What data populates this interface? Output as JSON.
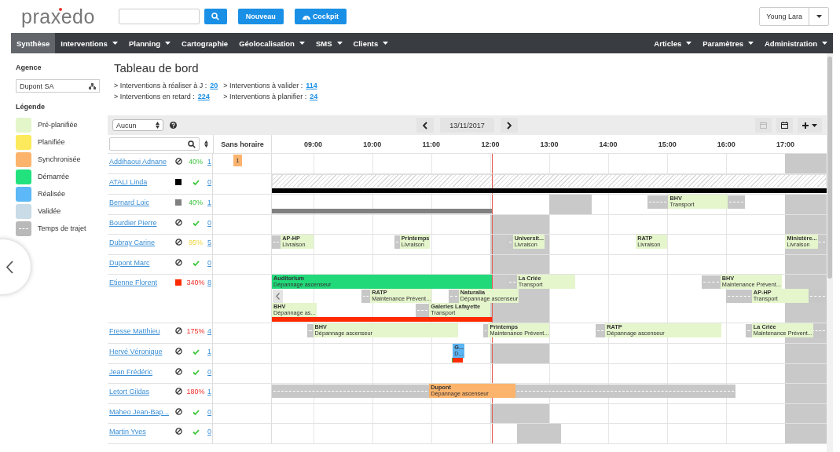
{
  "header": {
    "logo": "praxedo",
    "buttons": [
      {
        "label": "Nouveau",
        "kind": "text"
      },
      {
        "label": "Cockpit",
        "kind": "gauge"
      }
    ],
    "user": "Young Lara"
  },
  "nav": {
    "left": [
      {
        "label": "Synthèse",
        "selected": true,
        "dropdown": false
      },
      {
        "label": "Interventions",
        "selected": false,
        "dropdown": true
      },
      {
        "label": "Planning",
        "selected": false,
        "dropdown": true
      },
      {
        "label": "Cartographie",
        "selected": false,
        "dropdown": false
      },
      {
        "label": "Géolocalisation",
        "selected": false,
        "dropdown": true
      },
      {
        "label": "SMS",
        "selected": false,
        "dropdown": true
      },
      {
        "label": "Clients",
        "selected": false,
        "dropdown": true
      }
    ],
    "right": [
      {
        "label": "Articles",
        "selected": false,
        "dropdown": true
      },
      {
        "label": "Paramètres",
        "selected": false,
        "dropdown": true
      },
      {
        "label": "Administration",
        "selected": false,
        "dropdown": true
      }
    ]
  },
  "sidebar": {
    "agency_label": "Agence",
    "agency": "Dupont SA",
    "legend_title": "Légende",
    "legend": [
      {
        "label": "Pré-planifiée",
        "color": "#e3f6ca",
        "kind": "swatch"
      },
      {
        "label": "Planifiée",
        "color": "#fde95c",
        "kind": "swatch"
      },
      {
        "label": "Synchronisée",
        "color": "#fcb46c",
        "kind": "swatch"
      },
      {
        "label": "Démarrée",
        "color": "#22e27e",
        "kind": "swatch"
      },
      {
        "label": "Réalisée",
        "color": "#5cb8f6",
        "kind": "swatch"
      },
      {
        "label": "Validée",
        "color": "#c8dbe6",
        "kind": "swatch"
      },
      {
        "label": "Temps de trajet",
        "color": "#b9b9b9",
        "kind": "travel"
      }
    ]
  },
  "dashboard": {
    "title": "Tableau de bord",
    "stats": [
      {
        "label": "> Interventions à réaliser à J :",
        "value": "20"
      },
      {
        "label": "> Interventions à valider :",
        "value": "114"
      },
      {
        "label": "> Interventions en retard :",
        "value": "224"
      },
      {
        "label": "> Interventions à planifier :",
        "value": "24"
      }
    ]
  },
  "planning": {
    "filter": "Aucun",
    "date": "13/11/2017",
    "unassigned_header": "Sans horaire",
    "hours": [
      "09:00",
      "10:00",
      "11:00",
      "12:00",
      "13:00",
      "14:00",
      "15:00",
      "16:00",
      "17:00"
    ],
    "technicians": [
      {
        "name": "Addihaoui Adnane",
        "status": {
          "kind": "none"
        },
        "load": {
          "kind": "percent",
          "text": "40%",
          "warning": false,
          "overloaded": false
        },
        "count": "1",
        "unassigned": "1",
        "items": [
          {
            "kind": "off"
          }
        ]
      },
      {
        "name": "ATALI Linda",
        "status": {
          "kind": "square",
          "color": "#000000"
        },
        "load": {
          "kind": "check"
        },
        "count": "0",
        "items": [
          {
            "kind": "hatch"
          },
          {
            "kind": "bar",
            "color": "#000000"
          }
        ]
      },
      {
        "name": "Bernard Loic",
        "status": {
          "kind": "square",
          "color": "#808080"
        },
        "load": {
          "kind": "percent",
          "text": "40%",
          "warning": false,
          "overloaded": false
        },
        "count": "1",
        "items": [
          {
            "kind": "off"
          },
          {
            "kind": "off"
          },
          {
            "kind": "travel"
          },
          {
            "kind": "job",
            "color": "#e5f5cc",
            "title": "BHV",
            "subtitle": "Transport"
          },
          {
            "kind": "travel"
          },
          {
            "kind": "bar",
            "color": "#808080"
          }
        ]
      },
      {
        "name": "Bourdier Pierre",
        "status": {
          "kind": "none"
        },
        "load": {
          "kind": "check"
        },
        "count": "0",
        "items": [
          {
            "kind": "off"
          },
          {
            "kind": "off"
          }
        ]
      },
      {
        "name": "Dubray Carine",
        "status": {
          "kind": "none"
        },
        "load": {
          "kind": "percent",
          "text": "95%",
          "warning": true,
          "overloaded": false
        },
        "count": "5",
        "items": [
          {
            "kind": "off"
          },
          {
            "kind": "off"
          },
          {
            "kind": "travel"
          },
          {
            "kind": "job",
            "color": "#e5f5cc",
            "title": "AP-HP",
            "subtitle": "Livraison"
          },
          {
            "kind": "travel"
          },
          {
            "kind": "job",
            "color": "#e5f5cc",
            "title": "Printemps",
            "subtitle": "Livraison"
          },
          {
            "kind": "travel"
          },
          {
            "kind": "job",
            "color": "#e5f5cc",
            "title": "Universit...",
            "subtitle": "Livraison"
          },
          {
            "kind": "job",
            "color": "#e5f5cc",
            "title": "RATP",
            "subtitle": "Livraison"
          },
          {
            "kind": "job",
            "color": "#e5f5cc",
            "title": "Ministère...",
            "subtitle": "Livraison"
          },
          {
            "kind": "travel"
          }
        ]
      },
      {
        "name": "Dupont Marc",
        "status": {
          "kind": "none"
        },
        "load": {
          "kind": "check"
        },
        "count": "0",
        "items": [
          {
            "kind": "off"
          },
          {
            "kind": "off"
          }
        ]
      },
      {
        "name": "Etienne Florent",
        "status": {
          "kind": "square",
          "color": "#ff2a00"
        },
        "load": {
          "kind": "percent",
          "text": "340%",
          "warning": false,
          "overloaded": true
        },
        "count": "8",
        "items": [
          {
            "kind": "off"
          },
          {
            "kind": "off"
          },
          {
            "kind": "job",
            "color": "#22d97a",
            "title": "Auditorium",
            "subtitle": "Dépannage ascenseur"
          },
          {
            "kind": "travel"
          },
          {
            "kind": "job",
            "color": "#e5f5cc",
            "title": "La Criée",
            "subtitle": "Transport"
          },
          {
            "kind": "travel"
          },
          {
            "kind": "job",
            "color": "#e5f5cc",
            "title": "BHV",
            "subtitle": "Maintenance Prévent..."
          },
          {
            "kind": "scroll"
          },
          {
            "kind": "travel"
          },
          {
            "kind": "job",
            "color": "#e5f5cc",
            "title": "RATP",
            "subtitle": "Maintenance Prévent..."
          },
          {
            "kind": "travel"
          },
          {
            "kind": "job",
            "color": "#e5f5cc",
            "title": "Naturalia",
            "subtitle": "Dépannage ascenseur"
          },
          {
            "kind": "travel"
          },
          {
            "kind": "job",
            "color": "#e5f5cc",
            "title": "AP-HP",
            "subtitle": "Transport"
          },
          {
            "kind": "travel"
          },
          {
            "kind": "job",
            "color": "#e5f5cc",
            "title": "BHV",
            "subtitle": "Dépannage as..."
          },
          {
            "kind": "travel"
          },
          {
            "kind": "job",
            "color": "#e5f5cc",
            "title": "Galeries Lafayette",
            "subtitle": "Transport"
          },
          {
            "kind": "bar",
            "color": "#ff2a00"
          }
        ]
      },
      {
        "name": "Fresse Matthieu",
        "status": {
          "kind": "none"
        },
        "load": {
          "kind": "percent",
          "text": "175%",
          "warning": false,
          "overloaded": true
        },
        "count": "4",
        "items": [
          {
            "kind": "off"
          },
          {
            "kind": "travel"
          },
          {
            "kind": "job",
            "color": "#e5f5cc",
            "title": "BHV",
            "subtitle": "Dépannage ascenseur"
          },
          {
            "kind": "travel"
          },
          {
            "kind": "job",
            "color": "#e5f5cc",
            "title": "Printemps",
            "subtitle": "Maintenance Prévent..."
          },
          {
            "kind": "travel"
          },
          {
            "kind": "job",
            "color": "#e5f5cc",
            "title": "RATP",
            "subtitle": "Dépannage ascenseur"
          },
          {
            "kind": "travel"
          },
          {
            "kind": "job",
            "color": "#e5f5cc",
            "title": "La Criée",
            "subtitle": "Maintenance Prévent..."
          },
          {
            "kind": "travel"
          }
        ]
      },
      {
        "name": "Hervé Véronique",
        "status": {
          "kind": "none"
        },
        "load": {
          "kind": "check"
        },
        "count": "1",
        "items": [
          {
            "kind": "off"
          },
          {
            "kind": "off"
          },
          {
            "kind": "job",
            "color": "#5cb4f2",
            "title": "G...",
            "subtitle": "D..."
          },
          {
            "kind": "bar",
            "color": "#3cc63c"
          },
          {
            "kind": "bar",
            "color": "#ff2a00"
          }
        ]
      },
      {
        "name": "Jean Frédéric",
        "status": {
          "kind": "none"
        },
        "load": {
          "kind": "check"
        },
        "count": "0",
        "items": [
          {
            "kind": "off"
          }
        ]
      },
      {
        "name": "Letort Gildas",
        "status": {
          "kind": "none"
        },
        "load": {
          "kind": "percent",
          "text": "180%",
          "warning": false,
          "overloaded": true
        },
        "count": "1",
        "items": [
          {
            "kind": "off"
          },
          {
            "kind": "travel"
          },
          {
            "kind": "job",
            "color": "#fcb46c",
            "title": "Dupont",
            "subtitle": "Dépannage ascenseur"
          },
          {
            "kind": "travel"
          }
        ]
      },
      {
        "name": "Maheo Jean-Bap...",
        "status": {
          "kind": "none"
        },
        "load": {
          "kind": "check"
        },
        "count": "0",
        "items": [
          {
            "kind": "off"
          },
          {
            "kind": "off"
          }
        ]
      },
      {
        "name": "Martin Yves",
        "status": {
          "kind": "none"
        },
        "load": {
          "kind": "check"
        },
        "count": "0",
        "items": [
          {
            "kind": "off"
          },
          {
            "kind": "off"
          }
        ]
      }
    ]
  }
}
